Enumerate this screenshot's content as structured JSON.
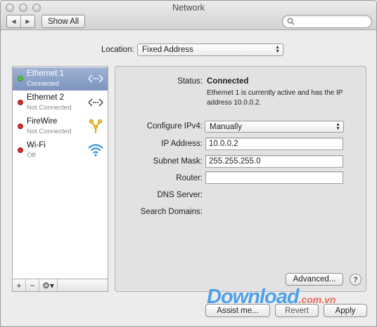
{
  "window": {
    "title": "Network"
  },
  "toolbar": {
    "back": "◀",
    "forward": "▶",
    "show_all_label": "Show All"
  },
  "location": {
    "label": "Location:",
    "value": "Fixed Address"
  },
  "services": [
    {
      "name": "Ethernet 1",
      "status": "Connected",
      "dot_color": "#5bbf3b",
      "icon": "ethernet-icon",
      "selected": true
    },
    {
      "name": "Ethernet 2",
      "status": "Not Connected",
      "dot_color": "#d92c2c",
      "icon": "ethernet-icon",
      "selected": false
    },
    {
      "name": "FireWire",
      "status": "Not Connected",
      "dot_color": "#d92c2c",
      "icon": "firewire-icon",
      "selected": false
    },
    {
      "name": "Wi-Fi",
      "status": "Off",
      "dot_color": "#d92c2c",
      "icon": "wifi-icon",
      "selected": false
    }
  ],
  "list_controls": {
    "add": "+",
    "remove": "−",
    "gear": "⚙▾"
  },
  "detail": {
    "status_label": "Status:",
    "status_value": "Connected",
    "status_desc": "Ethernet 1 is currently active and has the IP address 10.0.0.2.",
    "configure_label": "Configure IPv4:",
    "configure_value": "Manually",
    "ip_label": "IP Address:",
    "ip_value": "10.0.0.2",
    "subnet_label": "Subnet Mask:",
    "subnet_value": "255.255.255.0",
    "router_label": "Router:",
    "router_value": "",
    "dns_label": "DNS Server:",
    "search_domains_label": "Search Domains:",
    "advanced_label": "Advanced...",
    "help_label": "?"
  },
  "footer": {
    "assist_label": "Assist me...",
    "revert_label": "Revert",
    "apply_label": "Apply"
  },
  "watermark": {
    "main": "Download",
    "domain": ".com.vn"
  },
  "colors": {
    "selection": "#7d94bf",
    "connected": "#5bbf3b",
    "disconnected": "#d92c2c"
  }
}
